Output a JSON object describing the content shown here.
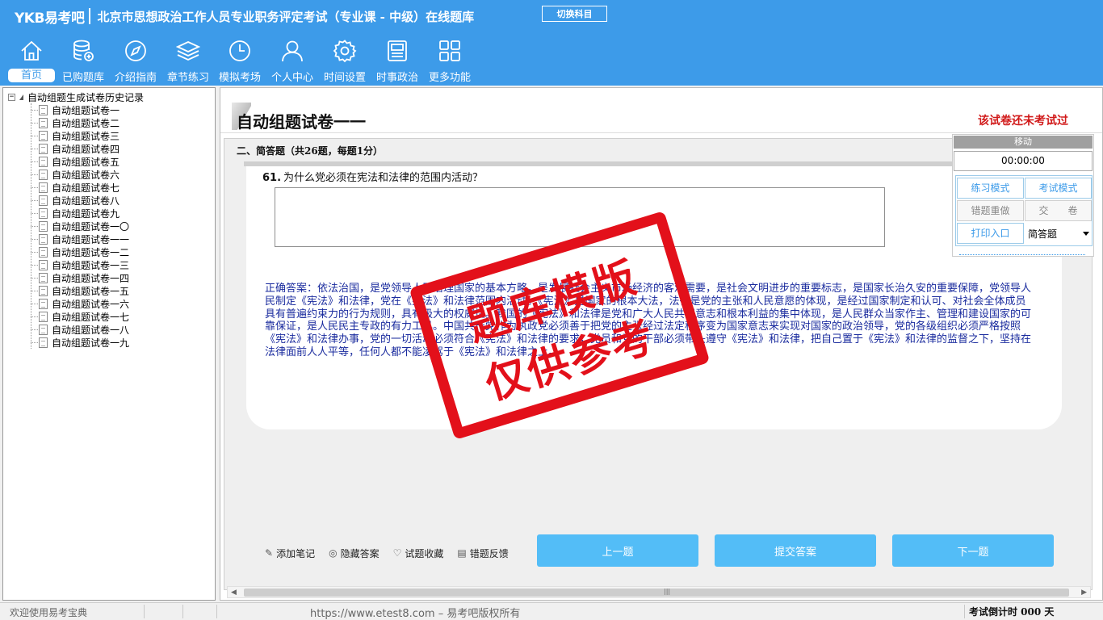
{
  "app": {
    "logo": "YKB易考吧",
    "title": "北京市思想政治工作人员专业职务评定考试（专业课 - 中级）在线题库",
    "switch_label": "切换科目"
  },
  "nav": [
    {
      "label": "首页",
      "icon": "home-icon"
    },
    {
      "label": "已购题库",
      "icon": "database-icon"
    },
    {
      "label": "介绍指南",
      "icon": "compass-icon"
    },
    {
      "label": "章节练习",
      "icon": "layers-icon"
    },
    {
      "label": "模拟考场",
      "icon": "clock-icon"
    },
    {
      "label": "个人中心",
      "icon": "user-icon"
    },
    {
      "label": "时间设置",
      "icon": "gear-icon"
    },
    {
      "label": "时事政治",
      "icon": "news-icon"
    },
    {
      "label": "更多功能",
      "icon": "grid-icon"
    }
  ],
  "tree": {
    "root_toggle": "−",
    "root_label": "自动组题生成试卷历史记录",
    "items": [
      "自动组题试卷一",
      "自动组题试卷二",
      "自动组题试卷三",
      "自动组题试卷四",
      "自动组题试卷五",
      "自动组题试卷六",
      "自动组题试卷七",
      "自动组题试卷八",
      "自动组题试卷九",
      "自动组题试卷一〇",
      "自动组题试卷一一",
      "自动组题试卷一二",
      "自动组题试卷一三",
      "自动组题试卷一四",
      "自动组题试卷一五",
      "自动组题试卷一六",
      "自动组题试卷一七",
      "自动组题试卷一八",
      "自动组题试卷一九"
    ]
  },
  "paper": {
    "title": "自动组题试卷一一",
    "status": "该试卷还未考试过",
    "section_header": "二、简答题（共26题，每题1分）"
  },
  "question": {
    "number": "61.",
    "text": "为什么党必须在宪法和法律的范围内活动？",
    "answer": "正确答案：依法治国，是党领导人民治理国家的基本方略，是发展社会主义市场经济的客观需要，是社会文明进步的重要标志，是国家长治久安的重要保障，党领导人民制定《宪法》和法律，党在《宪法》和法律范围内活动。《宪法》是国家的根本大法，法律是党的主张和人民意愿的体现，是经过国家制定和认可、对社会全体成员具有普遍约束力的行为规则，具有极大的权威性。我国的《宪法》和法律是党和广大人民共同意志和根本利益的集中体现，是人民群众当家作主、管理和建设国家的可靠保证，是人民民主专政的有力工具。中国共产党作为执政党必须善于把党的主张经过法定程序变为国家意志来实现对国家的政治领导，党的各级组织必须严格按照《宪法》和法律办事，党的一切活动必须符合《宪法》和法律的要求，党员和党的干部必须带头遵守《宪法》和法律，把自己置于《宪法》和法律的监督之下，坚持在法律面前人人平等，任何人都不能凌驾于《宪法》和法律之上。"
  },
  "toolbar": {
    "add_note": "添加笔记",
    "hide_answer": "隐藏答案",
    "favorite": "试题收藏",
    "report_error": "错题反馈",
    "prev": "上一题",
    "submit": "提交答案",
    "next": "下一题"
  },
  "panel": {
    "move": "移动",
    "timer": "00:00:00",
    "practice_mode": "练习模式",
    "exam_mode": "考试模式",
    "redo_wrong": "错题重做",
    "hand_in": "交　　卷",
    "print": "打印入口",
    "qtype_selected": "简答题"
  },
  "status": {
    "welcome": "欢迎使用易考宝典",
    "copyright": "https://www.etest8.com – 易考吧版权所有",
    "countdown": "考试倒计时 000 天"
  },
  "watermark": {
    "line1": "题库模版",
    "line2": "仅供参考"
  },
  "colors": {
    "header_blue": "#3d9be9",
    "button_blue": "#53bdf7",
    "answer_blue": "#1a2b9e",
    "status_red": "#d11a1a",
    "stamp_red": "#e3101a"
  }
}
